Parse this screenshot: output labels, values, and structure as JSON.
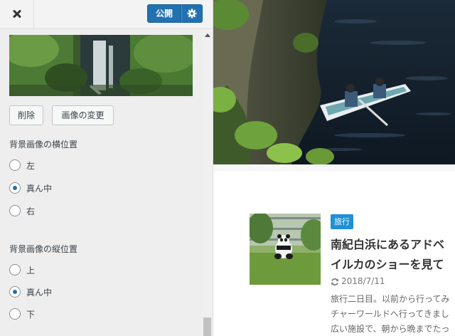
{
  "header": {
    "publish_label": "公開",
    "close_icon": "close-icon",
    "settings_icon": "gear-icon"
  },
  "background_image": {
    "remove_label": "削除",
    "change_label": "画像の変更"
  },
  "horizontal_position": {
    "label": "背景画像の横位置",
    "options": [
      "左",
      "真ん中",
      "右"
    ],
    "selected": "真ん中"
  },
  "vertical_position": {
    "label": "背景画像の縦位置",
    "options": [
      "上",
      "真ん中",
      "下"
    ],
    "selected": "真ん中"
  },
  "post": {
    "category": "旅行",
    "title_line1": "南紀白浜にあるアドベ",
    "title_line2": "イルカのショーを見て",
    "date": "2018/7/11",
    "excerpt_line1": "旅行二日目。以前から行ってみ",
    "excerpt_line2": "チャーワールドへ行ってきまし",
    "excerpt_line3": "広い施設で、朝から晩までたっ"
  },
  "colors": {
    "accent": "#2271b1",
    "category_badge": "#1e90d5"
  }
}
